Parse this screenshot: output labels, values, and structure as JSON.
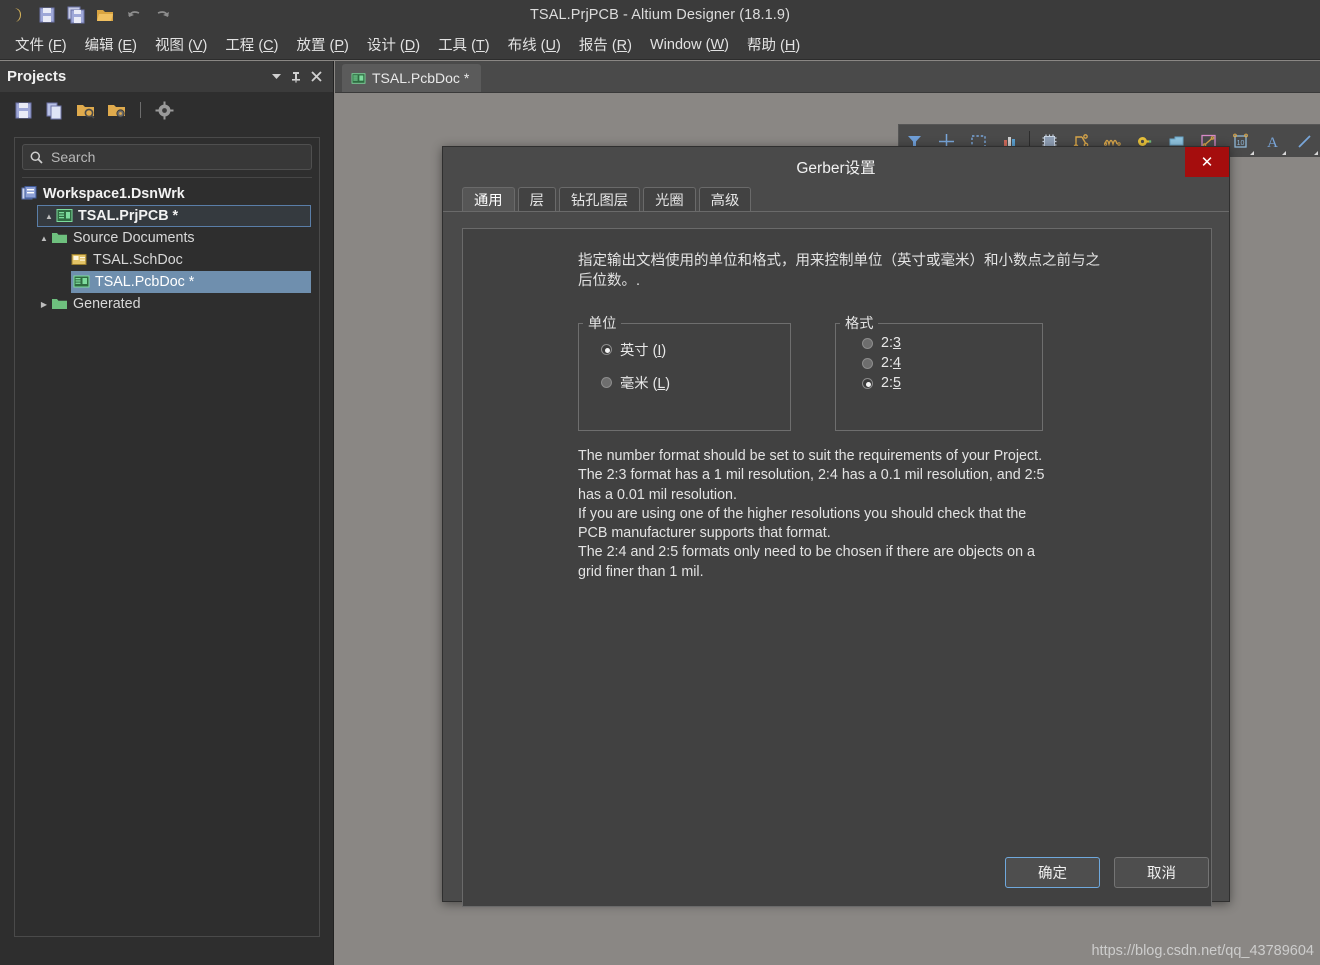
{
  "window": {
    "title": "TSAL.PrjPCB - Altium Designer (18.1.9)",
    "quick_access_icons": [
      "altium-logo-icon",
      "save-icon",
      "save-all-icon",
      "open-icon",
      "undo-icon",
      "redo-icon"
    ]
  },
  "menubar": {
    "items": [
      {
        "label": "文件",
        "key": "F"
      },
      {
        "label": "编辑",
        "key": "E"
      },
      {
        "label": "视图",
        "key": "V"
      },
      {
        "label": "工程",
        "key": "C"
      },
      {
        "label": "放置",
        "key": "P"
      },
      {
        "label": "设计",
        "key": "D"
      },
      {
        "label": "工具",
        "key": "T"
      },
      {
        "label": "布线",
        "key": "U"
      },
      {
        "label": "报告",
        "key": "R"
      },
      {
        "label": "Window",
        "key": "W"
      },
      {
        "label": "帮助",
        "key": "H"
      }
    ]
  },
  "panel": {
    "title": "Projects",
    "header_buttons": [
      "dropdown-arrow-icon",
      "pin-icon",
      "close-icon"
    ],
    "toolbar_icons": [
      "save-icon",
      "documents-icon",
      "open-project-icon",
      "project-options-icon",
      "gear-icon"
    ],
    "search": {
      "value": "",
      "placeholder": "Search",
      "icon": "search-icon"
    },
    "tree": [
      {
        "label": "Workspace1.DsnWrk",
        "level": 0,
        "icon": "workspace-icon",
        "arrow": "",
        "state": "bold"
      },
      {
        "label": "TSAL.PrjPCB *",
        "level": 1,
        "icon": "project-icon",
        "arrow": "▲",
        "state": "selected-outline"
      },
      {
        "label": "Source Documents",
        "level": 2,
        "icon": "folder-icon",
        "arrow": "▲",
        "state": "normal"
      },
      {
        "label": "TSAL.SchDoc",
        "level": 3,
        "icon": "sch-icon",
        "arrow": "",
        "state": "normal"
      },
      {
        "label": "TSAL.PcbDoc *",
        "level": 3,
        "icon": "pcb-icon",
        "arrow": "",
        "state": "selected-fill"
      },
      {
        "label": "Generated",
        "level": 2,
        "icon": "folder-icon",
        "arrow": "▶",
        "state": "normal"
      }
    ]
  },
  "editor": {
    "document_tab": {
      "label": "TSAL.PcbDoc *",
      "icon": "pcb-icon"
    },
    "pcb_toolbar_icons": [
      "filter-icon",
      "crosshair-icon",
      "select-rect-icon",
      "layer-stack-icon",
      "separator",
      "component-icon",
      "route-net-icon",
      "differential-pair-icon",
      "keepout-icon",
      "polygon-pour-icon",
      "dimension-icon",
      "drill-table-icon",
      "text-icon",
      "line-icon"
    ],
    "watermark": "https://blog.csdn.net/qq_43789604"
  },
  "dialog": {
    "title": "Gerber设置",
    "close_label": "✕",
    "tabs": [
      {
        "label": "通用",
        "active": true
      },
      {
        "label": "层",
        "active": false
      },
      {
        "label": "钻孔图层",
        "active": false
      },
      {
        "label": "光圈",
        "active": false
      },
      {
        "label": "高级",
        "active": false
      }
    ],
    "description_cn": "指定输出文档使用的单位和格式，用来控制单位（英寸或毫米）和小数点之前与之后位数。.",
    "units_group": {
      "legend": "单位",
      "options": [
        {
          "label": "英寸 (I)",
          "text": "英寸 (",
          "key": "I",
          "selected": true
        },
        {
          "label": "毫米 (L)",
          "text": "毫米 (",
          "key": "L",
          "selected": false
        }
      ]
    },
    "format_group": {
      "legend": "格式",
      "options": [
        {
          "label": "2:3",
          "text": "2:",
          "key": "3",
          "selected": false
        },
        {
          "label": "2:4",
          "text": "2:",
          "key": "4",
          "selected": false
        },
        {
          "label": "2:5",
          "text": "2:",
          "key": "5",
          "selected": true
        }
      ]
    },
    "description_en": [
      "The number format should be set to suit the requirements of your Project.",
      "The 2:3 format has a 1 mil resolution, 2:4 has a 0.1 mil resolution, and 2:5 has a 0.01 mil resolution.",
      "If you are using one of the higher resolutions you should check that the PCB manufacturer supports that format.",
      "The 2:4 and 2:5 formats only need to be chosen if there are objects on a grid finer than 1 mil."
    ],
    "buttons": {
      "ok": "确定",
      "cancel": "取消"
    }
  },
  "colors": {
    "titlebar_bg": "#3b3b3b",
    "panel_bg": "#2e2e2e",
    "canvas_bg": "#8a8784",
    "dialog_bg": "#4a4a4a",
    "dialog_body_bg": "#414141",
    "close_red": "#a50d0d",
    "selection_blue": "#6f8fae",
    "focus_blue": "#6fa8dc"
  }
}
